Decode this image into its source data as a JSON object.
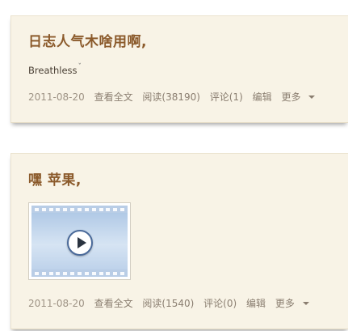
{
  "posts": [
    {
      "title": "日志人气木啥用啊,",
      "excerpt": "Breathless",
      "excerpt_mark": "ˇ",
      "date": "2011-08-20",
      "view_full": "查看全文",
      "reads": "阅读(38190)",
      "comments": "评论(1)",
      "edit": "编辑",
      "more": "更多"
    },
    {
      "title": "嘿  苹果,",
      "video_icon": "video-play-icon",
      "date": "2011-08-20",
      "view_full": "查看全文",
      "reads": "阅读(1540)",
      "comments": "评论(0)",
      "edit": "编辑",
      "more": "更多"
    }
  ],
  "colors": {
    "card_bg": "#f8f3e6",
    "title": "#8b5a2b",
    "meta": "#9e9385"
  }
}
